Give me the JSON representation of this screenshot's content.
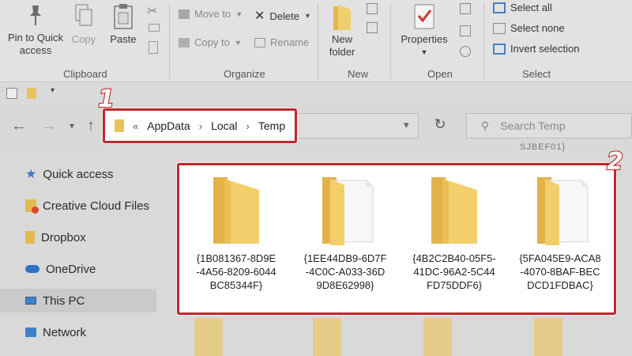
{
  "ribbon": {
    "clipboard": {
      "pin_label_1": "Pin to Quick",
      "pin_label_2": "access",
      "copy_label": "Copy",
      "paste_label": "Paste",
      "group": "Clipboard"
    },
    "organize": {
      "move_to": "Move to",
      "copy_to": "Copy to",
      "delete": "Delete",
      "rename": "Rename",
      "group": "Organize"
    },
    "new": {
      "new_folder_1": "New",
      "new_folder_2": "folder",
      "group": "New"
    },
    "open": {
      "properties": "Properties",
      "group": "Open"
    },
    "select": {
      "select_all": "Select all",
      "select_none": "Select none",
      "invert": "Invert selection",
      "group": "Select"
    }
  },
  "address": {
    "overflow": "«",
    "crumbs": [
      "AppData",
      "Local",
      "Temp"
    ]
  },
  "search": {
    "placeholder": "Search Temp"
  },
  "faint_label": "SJBEF01}",
  "annotations": {
    "marker_1": "1",
    "marker_2": "2"
  },
  "nav_pane": {
    "items": [
      {
        "label": "Quick access",
        "icon": "star-icon"
      },
      {
        "label": "Creative Cloud Files",
        "icon": "creative-cloud-icon"
      },
      {
        "label": "Dropbox",
        "icon": "dropbox-icon"
      },
      {
        "label": "OneDrive",
        "icon": "cloud-icon"
      },
      {
        "label": "This PC",
        "icon": "monitor-icon"
      },
      {
        "label": "Network",
        "icon": "network-icon"
      }
    ]
  },
  "folders": [
    {
      "line1": "{1B081367-8D9E",
      "line2": "-4A56-8209-6044",
      "line3": "BC85344F}",
      "has_files": false
    },
    {
      "line1": "{1EE44DB9-6D7F",
      "line2": "-4C0C-A033-36D",
      "line3": "9D8E62998}",
      "has_files": true
    },
    {
      "line1": "{4B2C2B40-05F5-",
      "line2": "41DC-96A2-5C44",
      "line3": "FD75DDF6}",
      "has_files": false
    },
    {
      "line1": "{5FA045E9-ACA8",
      "line2": "-4070-8BAF-BEC",
      "line3": "DCD1FDBAC}",
      "has_files": true
    }
  ],
  "colors": {
    "highlight_red": "#c0282c",
    "folder_yellow": "#f2cf6b",
    "folder_back": "#e8b94a"
  }
}
